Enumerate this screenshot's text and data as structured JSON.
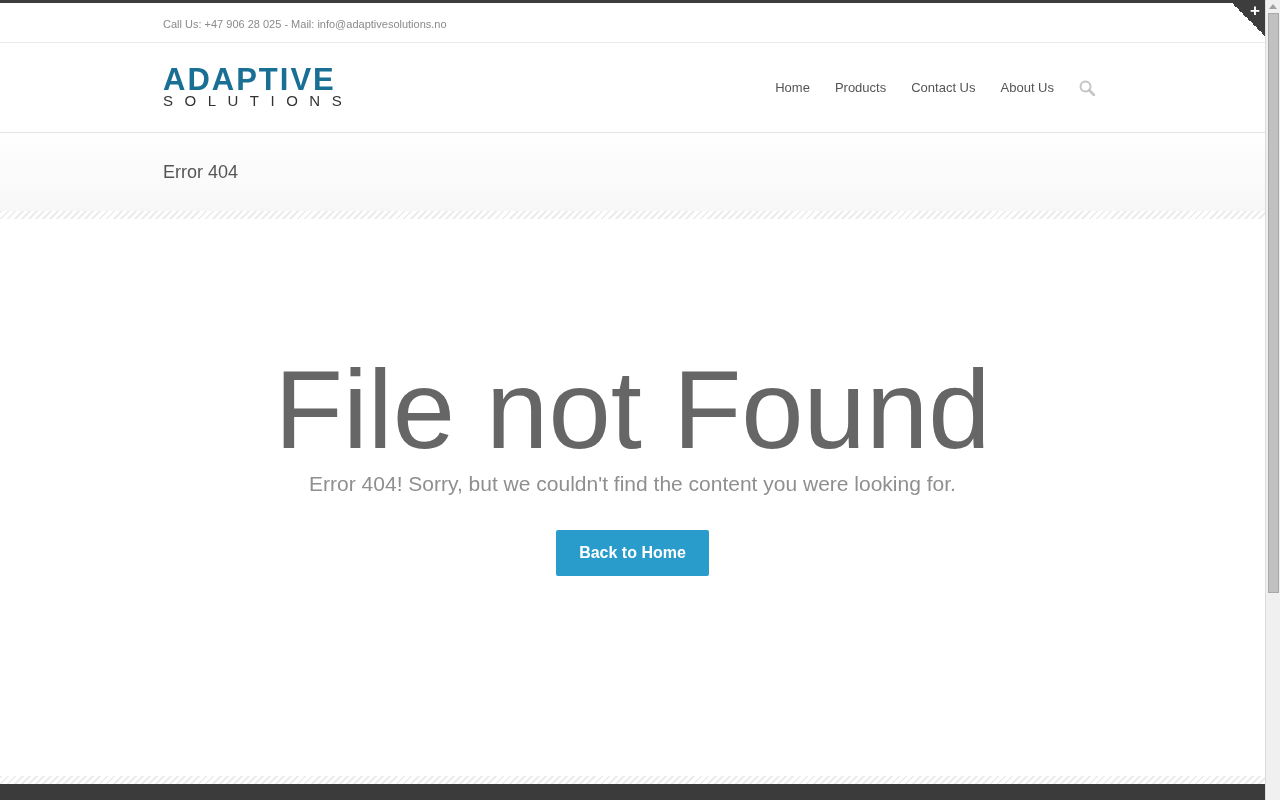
{
  "topbar": {
    "contact": "Call Us: +47 906 28 025 - Mail: info@adaptivesolutions.no",
    "corner_toggle": "+"
  },
  "logo": {
    "line1": "ADAPTIVE",
    "line2": "SOLUTIONS"
  },
  "nav": {
    "items": [
      {
        "label": "Home"
      },
      {
        "label": "Products"
      },
      {
        "label": "Contact Us"
      },
      {
        "label": "About Us"
      }
    ]
  },
  "page_title": "Error 404",
  "error": {
    "heading": "File not Found",
    "message": "Error 404! Sorry, but we couldn't find the content you were looking for.",
    "button": "Back to Home"
  }
}
